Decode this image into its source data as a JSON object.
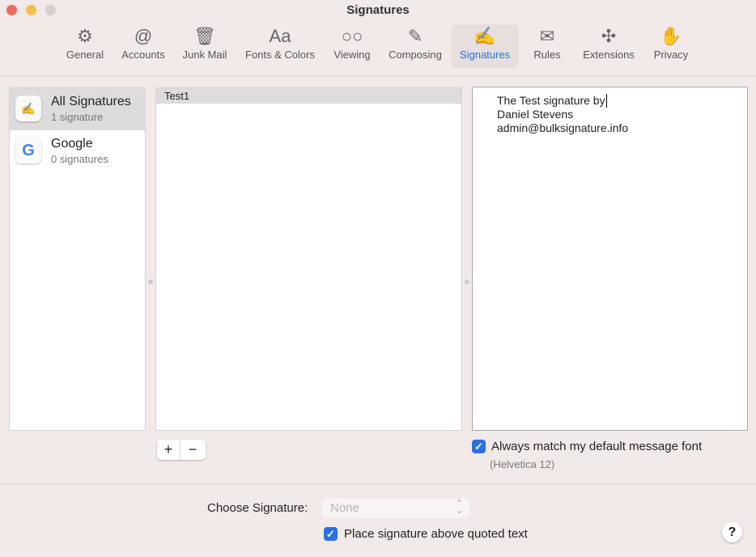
{
  "window": {
    "title": "Signatures"
  },
  "toolbar": [
    {
      "label": "General",
      "icon": "gear-icon",
      "glyph": "⚙"
    },
    {
      "label": "Accounts",
      "icon": "at-icon",
      "glyph": "@"
    },
    {
      "label": "Junk Mail",
      "icon": "junk-mail-icon",
      "glyph": "🗑"
    },
    {
      "label": "Fonts & Colors",
      "icon": "fonts-icon",
      "glyph": "Aa"
    },
    {
      "label": "Viewing",
      "icon": "glasses-icon",
      "glyph": "○○"
    },
    {
      "label": "Composing",
      "icon": "compose-icon",
      "glyph": "✎"
    },
    {
      "label": "Signatures",
      "icon": "signature-icon",
      "glyph": "✍"
    },
    {
      "label": "Rules",
      "icon": "rules-icon",
      "glyph": "✉"
    },
    {
      "label": "Extensions",
      "icon": "puzzle-icon",
      "glyph": "✣"
    },
    {
      "label": "Privacy",
      "icon": "hand-icon",
      "glyph": "✋"
    }
  ],
  "accounts": [
    {
      "name": "All Signatures",
      "count": "1 signature",
      "selected": true
    },
    {
      "name": "Google",
      "count": "0 signatures",
      "selected": false
    }
  ],
  "signatures": [
    "Test1"
  ],
  "editor": {
    "lines": [
      "The Test signature by",
      "Daniel Stevens",
      "admin@bulksignature.info"
    ]
  },
  "buttons": {
    "add": "+",
    "remove": "−",
    "help": "?"
  },
  "match_font": {
    "label": "Always match my default message font",
    "checked": true,
    "font": "(Helvetica 12)"
  },
  "choose": {
    "label": "Choose Signature:",
    "value": "None"
  },
  "place_above": {
    "label": "Place signature above quoted text",
    "checked": true
  },
  "colors": {
    "accent": "#2a6fe6",
    "background": "#f2eae8"
  }
}
